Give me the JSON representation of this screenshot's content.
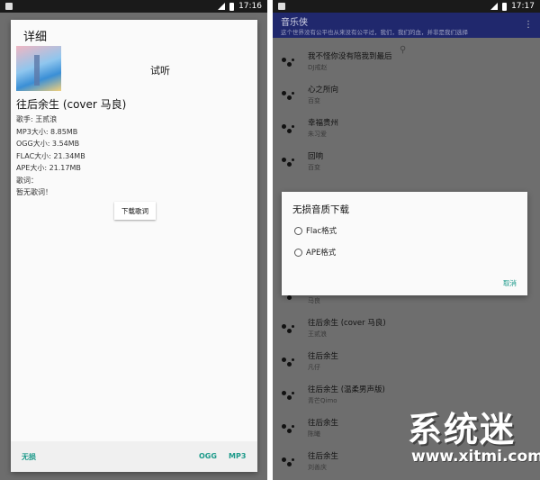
{
  "left": {
    "statusbar": {
      "time": "17:16"
    },
    "dialog": {
      "title": "详细",
      "listen_label": "试听",
      "song_title": "往后余生 (cover 马良)",
      "meta": [
        "歌手: 王贰浪",
        "MP3大小: 8.85MB",
        "OGG大小: 3.54MB",
        "FLAC大小: 21.34MB",
        "APE大小: 21.17MB",
        "歌词：",
        "暂无歌词！"
      ],
      "download_lyrics_label": "下载歌词",
      "footer": {
        "lossless": "无损",
        "ogg": "OGG",
        "mp3": "MP3"
      }
    }
  },
  "right": {
    "statusbar": {
      "time": "17:17"
    },
    "appbar": {
      "title": "音乐侠",
      "subtitle": "这个世界没有公平也从来没有公平过，我们，我们的血，并非是我们选择",
      "menu_icon": "more-vert-icon"
    },
    "songs": [
      {
        "name": "我不怪你没有陪我到最后",
        "artist": "DJ戒赵"
      },
      {
        "name": "心之所向",
        "artist": "百变"
      },
      {
        "name": "幸福贵州",
        "artist": "朱习爱"
      },
      {
        "name": "回响",
        "artist": "百变"
      },
      {
        "name": "",
        "artist": "马良"
      },
      {
        "name": "往后余生 (cover 马良)",
        "artist": "王贰浪"
      },
      {
        "name": "往后余生",
        "artist": "凡仔"
      },
      {
        "name": "往后余生 (温柔男声版)",
        "artist": "青芒Qimo"
      },
      {
        "name": "往后余生",
        "artist": "陈曦"
      },
      {
        "name": "往后余生",
        "artist": "刘善庆"
      }
    ],
    "quality_dialog": {
      "title": "无损音质下载",
      "options": [
        "Flac格式",
        "APE格式"
      ],
      "cancel": "取消"
    }
  },
  "watermark": {
    "text": "系统迷",
    "url": "www.xitmi.com"
  },
  "colors": {
    "appbar": "#20286d",
    "accent": "#1c9a8a",
    "status_bar": "#1a1a1a"
  }
}
